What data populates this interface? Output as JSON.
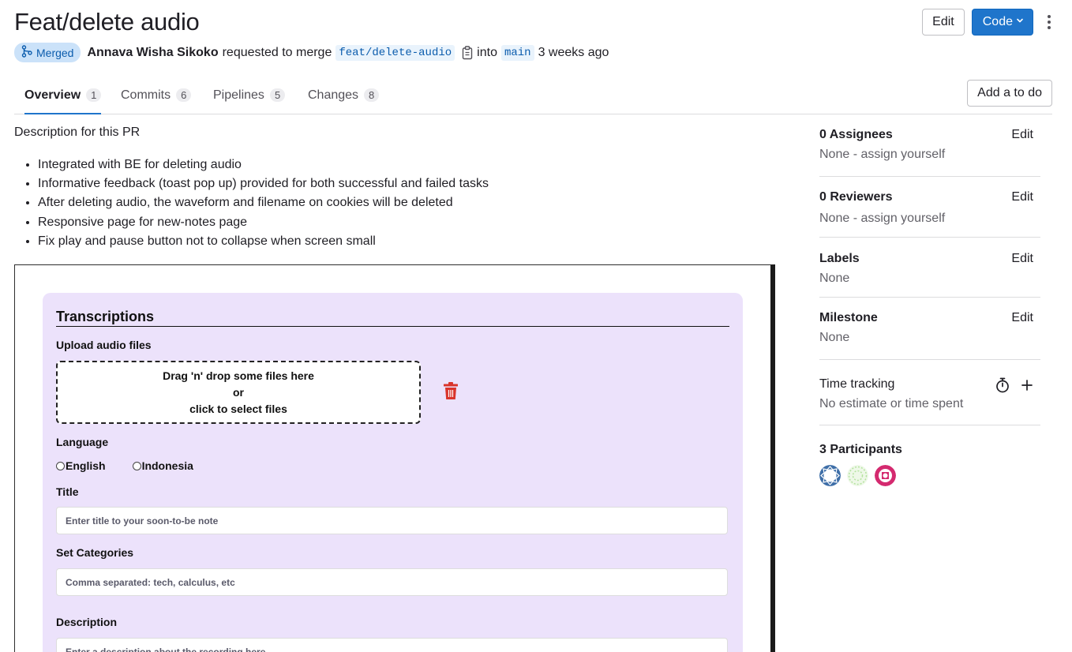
{
  "header": {
    "title": "Feat/delete audio",
    "edit_label": "Edit",
    "code_label": "Code"
  },
  "meta": {
    "status": "Merged",
    "author": "Annava Wisha Sikoko",
    "action_text": "requested to merge",
    "source_branch": "feat/delete-audio",
    "into_text": "into",
    "target_branch": "main",
    "time": "3 weeks ago"
  },
  "tabs": [
    {
      "label": "Overview",
      "count": "1"
    },
    {
      "label": "Commits",
      "count": "6"
    },
    {
      "label": "Pipelines",
      "count": "5"
    },
    {
      "label": "Changes",
      "count": "8"
    }
  ],
  "todo_label": "Add a to do",
  "description": {
    "intro": "Description for this PR",
    "bullets": [
      "Integrated with BE for deleting audio",
      "Informative feedback (toast pop up) provided for both successful and failed tasks",
      "After deleting audio, the waveform and filename on cookies will be deleted",
      "Responsive page for new-notes page",
      "Fix play and pause button not to collapse when screen small"
    ]
  },
  "screenshot": {
    "title": "Transcriptions",
    "upload_label": "Upload audio files",
    "dropzone_line1": "Drag 'n' drop some files here",
    "dropzone_line2": "or",
    "dropzone_line3": "click to select files",
    "language_label": "Language",
    "lang_en": "English",
    "lang_id": "Indonesia",
    "title_label": "Title",
    "title_placeholder": "Enter title to your soon-to-be note",
    "categories_label": "Set Categories",
    "categories_placeholder": "Comma separated: tech, calculus, etc",
    "description_label": "Description",
    "description_placeholder": "Enter a description about the recording here"
  },
  "sidebar": {
    "assignees": {
      "heading": "0 Assignees",
      "value": "None - assign yourself",
      "edit": "Edit"
    },
    "reviewers": {
      "heading": "0 Reviewers",
      "value": "None - assign yourself",
      "edit": "Edit"
    },
    "labels": {
      "heading": "Labels",
      "value": "None",
      "edit": "Edit"
    },
    "milestone": {
      "heading": "Milestone",
      "value": "None",
      "edit": "Edit"
    },
    "time_tracking": {
      "heading": "Time tracking",
      "value": "No estimate or time spent"
    },
    "participants": {
      "heading": "3 Participants"
    }
  },
  "colors": {
    "accent": "#1f75cb",
    "merged_badge_bg": "#cbe2f9",
    "panel_bg": "#ece2fb",
    "trash": "#d9342b"
  },
  "icons": {
    "merged": "merge-icon",
    "copy": "copy-icon",
    "code_caret": "chevron-down-icon",
    "more": "kebab-icon",
    "trash": "trash-icon",
    "timer": "stopwatch-icon",
    "add": "plus-icon"
  }
}
